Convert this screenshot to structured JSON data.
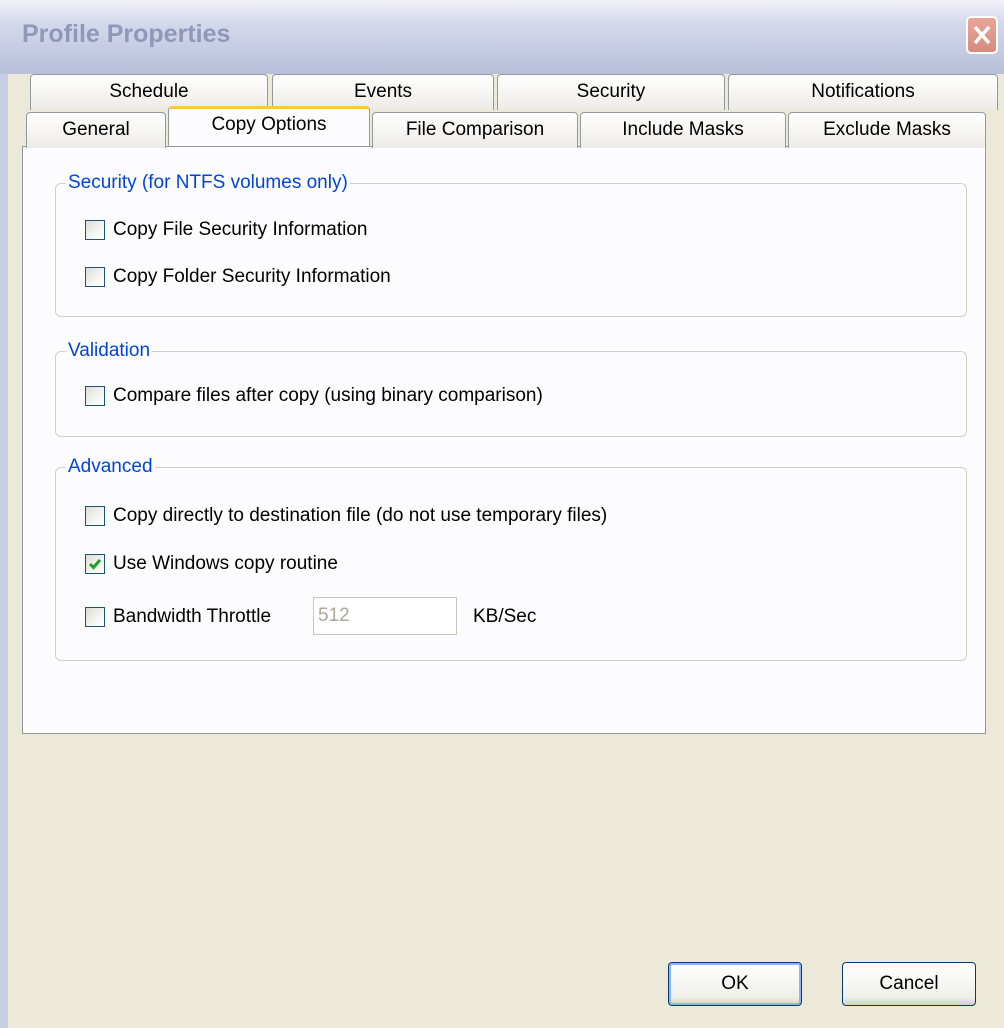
{
  "window": {
    "title": "Profile Properties"
  },
  "tabs": {
    "back": [
      {
        "label": "Schedule"
      },
      {
        "label": "Events"
      },
      {
        "label": "Security"
      },
      {
        "label": "Notifications"
      }
    ],
    "front": [
      {
        "label": "General"
      },
      {
        "label": "Copy Options"
      },
      {
        "label": "File Comparison"
      },
      {
        "label": "Include Masks"
      },
      {
        "label": "Exclude Masks"
      }
    ],
    "active": "Copy Options"
  },
  "security_group": {
    "legend": "Security (for NTFS volumes only)",
    "copy_file_security": {
      "label": "Copy File Security Information",
      "checked": false
    },
    "copy_folder_security": {
      "label": "Copy Folder Security Information",
      "checked": false
    }
  },
  "validation_group": {
    "legend": "Validation",
    "compare_after_copy": {
      "label": "Compare files after copy (using binary comparison)",
      "checked": false
    }
  },
  "advanced_group": {
    "legend": "Advanced",
    "copy_directly": {
      "label": "Copy directly to destination file (do not use temporary files)",
      "checked": false
    },
    "windows_copy_routine": {
      "label": "Use Windows copy routine",
      "checked": true
    },
    "bandwidth_throttle": {
      "label": "Bandwidth Throttle",
      "checked": false,
      "value": "512",
      "unit": "KB/Sec"
    }
  },
  "buttons": {
    "ok": "OK",
    "cancel": "Cancel"
  },
  "colors": {
    "accent_tab": "#FFC83C",
    "group_legend": "#0046D5",
    "check_mark": "#21A121",
    "close_button": "#D58C7D"
  },
  "icons": {
    "close": "close-x-icon",
    "check": "check-mark-icon"
  }
}
